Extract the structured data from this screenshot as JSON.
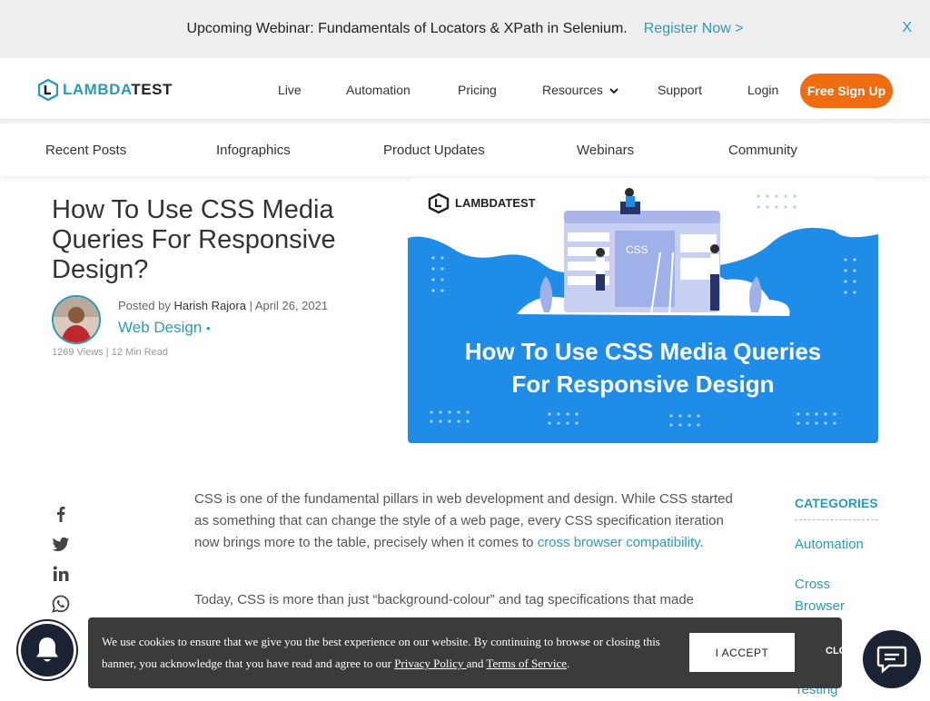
{
  "webinar": {
    "text": "Upcoming Webinar: Fundamentals of Locators & XPath in Selenium.",
    "register_label": "Register Now >",
    "close_label": "X"
  },
  "header": {
    "logo_prefix": "LAMBDA",
    "logo_suffix": "TEST",
    "nav": [
      "Live",
      "Automation",
      "Pricing",
      "Resources",
      "Support",
      "Login"
    ],
    "signup_label": "Free Sign Up"
  },
  "subnav": [
    "Recent Posts",
    "Infographics",
    "Product Updates",
    "Webinars",
    "Community"
  ],
  "article": {
    "title": "How To Use CSS Media Queries For Responsive Design?",
    "posted_by": "Posted by",
    "author": "Harish Rajora",
    "separator": "|",
    "date": "April 26, 2021",
    "category": "Web Design",
    "category_dot": "•",
    "views": "1269 Views",
    "read_time": "12 Min Read"
  },
  "hero": {
    "logo": "LAMBDATEST",
    "css_label": "CSS",
    "line1": "How To Use CSS Media Queries",
    "line2": "For Responsive Design"
  },
  "body": {
    "p1_a": "CSS is one of the fundamental pillars in web development and design. While CSS started as something that can change the style of a web page, every CSS specification iteration now brings more to the table, precisely when it comes to ",
    "p1_link": "cross browser compatibility",
    "p1_b": ".",
    "p2": "Today, CSS is more than just “background-colour” and tag specifications that made"
  },
  "sidebar": {
    "title": "CATEGORIES",
    "items": [
      "Automation",
      "Cross Browser",
      "Testing"
    ]
  },
  "cookie": {
    "text_a": "We use cookies to ensure that we give you the best experience on our website. By continuing to browse or closing this banner, you acknowledge that you have read and agree to our ",
    "privacy": "Privacy Policy ",
    "and": "and ",
    "terms": "Terms of Service",
    "period": ".",
    "accept": "I ACCEPT",
    "close": "CLO"
  },
  "colors": {
    "accent": "#2a9bb7",
    "signup": "#ef6c12",
    "hero_bg": "#1f8de8",
    "cookie_bg": "#3b3b3b"
  }
}
